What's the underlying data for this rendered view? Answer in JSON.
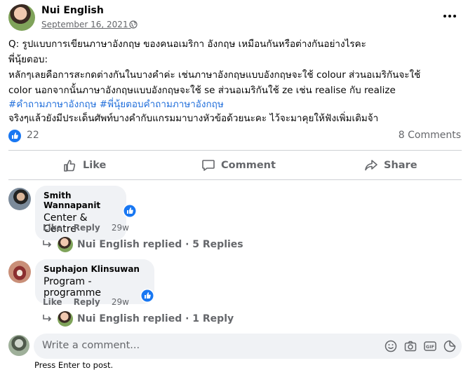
{
  "post": {
    "author": "Nui English",
    "date": "September 16, 2021",
    "separator": "·",
    "lines": [
      "Q: รูปแบบการเขียนภาษาอังกฤษ ของคนอเมริกา อังกฤษ เหมือนกันหรือต่างกันอย่างไรคะ",
      "พี่นุ้ยตอบ:",
      "หลักๆเลยคือการสะกดต่างกันในบางคำค่ะ เช่นภาษาอังกฤษแบบอังกฤษจะใช้ colour ส่วนอเมริกันจะใช้",
      "color นอกจากนั้นภาษาอังกฤษแบบอังกฤษจะใช้ se ส่วนอเมริกันใช้ ze เช่น realise กับ realize"
    ],
    "hashtags": [
      "#คำถามภาษาอังกฤษ",
      "#พี่นุ้ยตอบคำถามภาษาอังกฤษ"
    ],
    "last_line": "จริงๆแล้วยังมีประเด็นศัพท์บางคำกับแกรมมาบางหัวข้อด้วยนะคะ ไว้จะมาคุยให้ฟังเพิ่มเติมจ้า",
    "reaction_count": "22",
    "comments_count": "8 Comments"
  },
  "actions": {
    "like": "Like",
    "comment": "Comment",
    "share": "Share"
  },
  "comments": [
    {
      "author": "Smith Wannapanit",
      "text": "Center & Centre",
      "like": "Like",
      "reply": "Reply",
      "time": "29w",
      "replies": "Nui English replied · 5 Replies"
    },
    {
      "author": "Suphajon Klinsuwan",
      "text": "Program - programme",
      "like": "Like",
      "reply": "Reply",
      "time": "29w",
      "replies": "Nui English replied · 1 Reply"
    }
  ],
  "composer": {
    "placeholder": "Write a comment...",
    "hint": "Press Enter to post."
  },
  "colors": {
    "accent": "#1877f2",
    "hashtag": "#216fdb",
    "muted": "#65676b",
    "bubble": "#f0f2f5"
  },
  "icons": [
    "globe-icon",
    "more-icon",
    "like-reaction-icon",
    "thumbs-up-icon",
    "comment-icon",
    "share-icon",
    "reply-arrow-icon",
    "emoji-icon",
    "camera-icon",
    "gif-icon",
    "sticker-icon"
  ]
}
